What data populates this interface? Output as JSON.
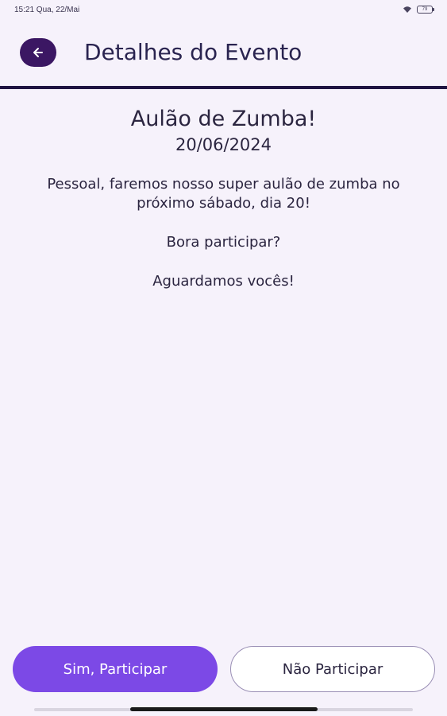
{
  "status_bar": {
    "time_date": "15:21 Qua, 22/Mai",
    "battery": "79"
  },
  "header": {
    "title": "Detalhes do Evento"
  },
  "event": {
    "title": "Aulão de Zumba!",
    "date": "20/06/2024",
    "description": [
      "Pessoal, faremos nosso super aulão de zumba no próximo sábado, dia 20!",
      "Bora participar?",
      "Aguardamos vocês!"
    ]
  },
  "actions": {
    "participate_label": "Sim, Participar",
    "decline_label": "Não Participar"
  },
  "colors": {
    "background": "#f6f2fb",
    "accent": "#7c49e6",
    "header_button": "#3b1763",
    "divider": "#1f1442"
  },
  "icons": {
    "back": "arrow-left-icon",
    "wifi": "wifi-icon",
    "battery": "battery-icon"
  }
}
